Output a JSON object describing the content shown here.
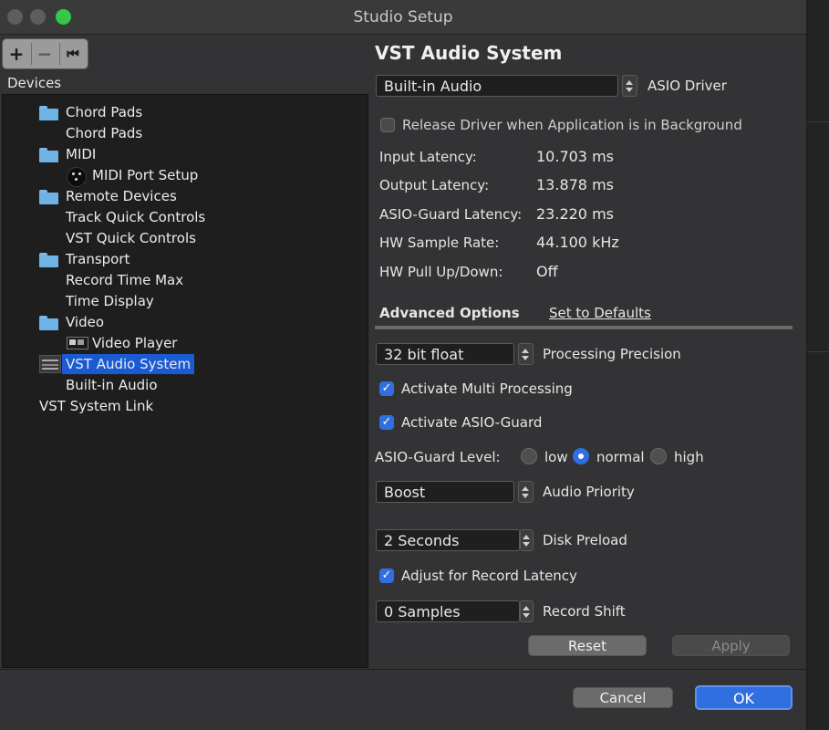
{
  "window": {
    "title": "Studio Setup"
  },
  "toolbar": {
    "add_label": "+",
    "remove_label": "−",
    "reset_label": "⏮"
  },
  "devices": {
    "label": "Devices",
    "items": [
      {
        "label": "Chord Pads",
        "icon": "folder-icon"
      },
      {
        "label": "Chord Pads"
      },
      {
        "label": "MIDI",
        "icon": "folder-icon"
      },
      {
        "label": "MIDI Port Setup",
        "icon": "midi-port-icon"
      },
      {
        "label": "Remote Devices",
        "icon": "folder-icon"
      },
      {
        "label": "Track Quick Controls"
      },
      {
        "label": "VST Quick Controls"
      },
      {
        "label": "Transport",
        "icon": "folder-icon"
      },
      {
        "label": "Record Time Max"
      },
      {
        "label": "Time Display"
      },
      {
        "label": "Video",
        "icon": "folder-icon"
      },
      {
        "label": "Video Player",
        "icon": "video-player-icon"
      },
      {
        "label": "VST Audio System",
        "icon": "audio-system-icon",
        "selected": true
      },
      {
        "label": "Built-in Audio"
      },
      {
        "label": "VST System Link"
      }
    ]
  },
  "panel": {
    "title": "VST Audio System",
    "driver": {
      "value": "Built-in Audio",
      "label": "ASIO Driver"
    },
    "release_driver": {
      "label": "Release Driver when Application is in Background",
      "checked": false
    },
    "latency": [
      {
        "label": "Input Latency:",
        "value": "10.703 ms"
      },
      {
        "label": "Output Latency:",
        "value": "13.878 ms"
      },
      {
        "label": "ASIO-Guard Latency:",
        "value": "23.220 ms"
      },
      {
        "label": "HW Sample Rate:",
        "value": "44.100 kHz"
      },
      {
        "label": "HW Pull Up/Down:",
        "value": "Off"
      }
    ],
    "advanced_options_label": "Advanced Options",
    "set_defaults_label": "Set to Defaults",
    "precision": {
      "value": "32 bit float",
      "label": "Processing Precision"
    },
    "multi_processing": {
      "label": "Activate Multi Processing",
      "checked": true
    },
    "asio_guard": {
      "label": "Activate ASIO-Guard",
      "checked": true
    },
    "asio_guard_level": {
      "label": "ASIO-Guard Level:",
      "options": [
        "low",
        "normal",
        "high"
      ],
      "selected": "normal"
    },
    "priority": {
      "value": "Boost",
      "label": "Audio Priority"
    },
    "disk_preload": {
      "value": "2 Seconds",
      "label": "Disk Preload"
    },
    "record_latency": {
      "label": "Adjust for Record Latency",
      "checked": true
    },
    "record_shift": {
      "value": "0 Samples",
      "label": "Record Shift"
    },
    "reset_label": "Reset",
    "apply_label": "Apply"
  },
  "footer": {
    "cancel_label": "Cancel",
    "ok_label": "OK"
  },
  "colors": {
    "accent": "#2f6fe0",
    "selection": "#1a5bd4",
    "folder": "#6fb3e6"
  }
}
